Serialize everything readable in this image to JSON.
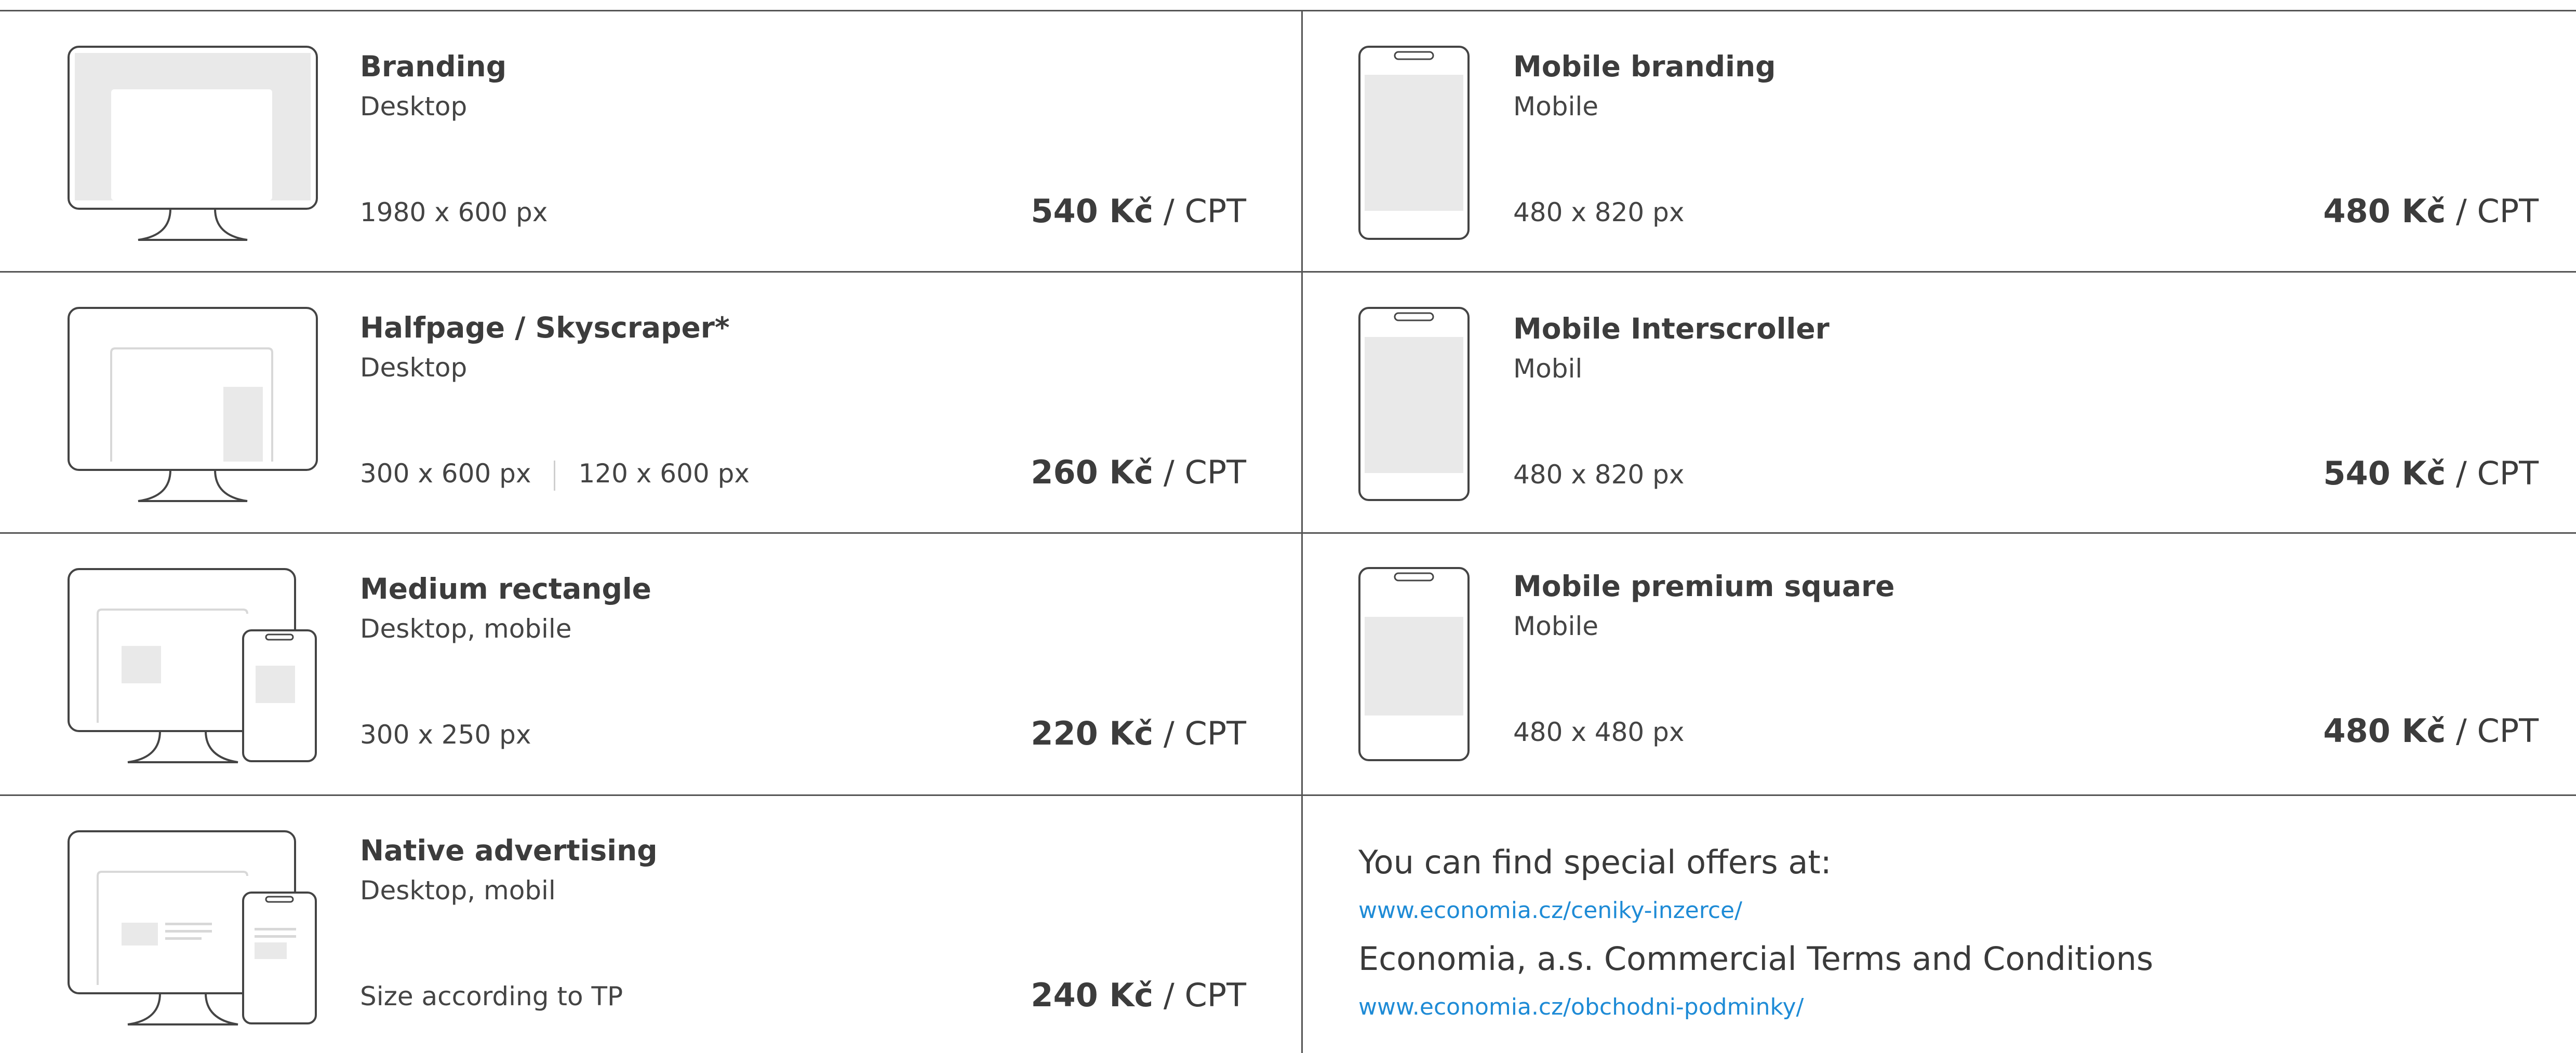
{
  "left_items": [
    {
      "title": "Branding",
      "subtitle": "Desktop",
      "size": "1980 x 600 px",
      "price_amount": "540 Kč",
      "price_unit": " / CPT",
      "icon": "desktop-branding-icon"
    },
    {
      "title": "Halfpage / Skyscraper*",
      "subtitle": "Desktop",
      "size": "300 x 600 px",
      "size2": "120 x 600 px",
      "price_amount": "260 Kč",
      "price_unit": " / CPT",
      "icon": "desktop-halfpage-icon"
    },
    {
      "title": "Medium rectangle",
      "subtitle": "Desktop, mobile",
      "size": "300 x 250 px",
      "price_amount": "220 Kč",
      "price_unit": " / CPT",
      "icon": "desktop-mobile-rectangle-icon"
    },
    {
      "title": "Native advertising",
      "subtitle": "Desktop, mobil",
      "size": "Size according to TP",
      "price_amount": "240 Kč",
      "price_unit": " / CPT",
      "icon": "desktop-mobile-native-icon"
    }
  ],
  "right_items": [
    {
      "title": "Mobile branding",
      "subtitle": "Mobile",
      "size": "480 x 820 px",
      "price_amount": "480 Kč",
      "price_unit": " / CPT",
      "icon": "mobile-branding-icon"
    },
    {
      "title": "Mobile Interscroller",
      "subtitle": "Mobil",
      "size": "480 x 820 px",
      "price_amount": "540 Kč",
      "price_unit": " / CPT",
      "icon": "mobile-interscroller-icon"
    },
    {
      "title": "Mobile premium square",
      "subtitle": "Mobile",
      "size": "480 x 480 px",
      "price_amount": "480 Kč",
      "price_unit": " / CPT",
      "icon": "mobile-square-icon"
    }
  ],
  "offers": {
    "heading": "You can find special offers at:",
    "link1": "www.economia.cz/ceniky-inzerce/",
    "terms": "Economia, a.s. Commercial Terms and Conditions",
    "link2": "www.economia.cz/obchodni-podminky/"
  },
  "colors": {
    "line": "#555555",
    "placeholder": "#e9e9e9",
    "link": "#1e8bd6",
    "text": "#3a3a3a"
  }
}
